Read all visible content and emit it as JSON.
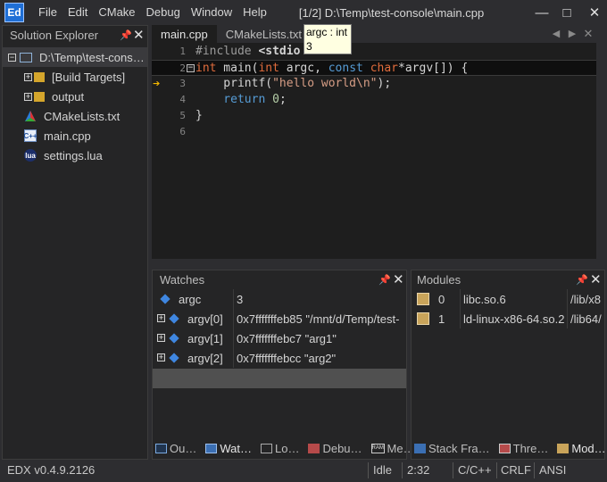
{
  "app": {
    "logo": "Ed",
    "window_title": "[1/2] D:\\Temp\\test-console\\main.cpp",
    "menu": [
      "File",
      "Edit",
      "CMake",
      "Debug",
      "Window",
      "Help"
    ],
    "window_buttons": {
      "minimize": "—",
      "maximize": "□",
      "close": "✕"
    }
  },
  "solution_explorer": {
    "title": "Solution Explorer",
    "items": [
      {
        "label": "D:\\Temp\\test-cons…",
        "icon": "solution-icon",
        "expander": "⊟"
      },
      {
        "label": "[Build Targets]",
        "icon": "build-targets-folder-icon",
        "expander": "+"
      },
      {
        "label": "output",
        "icon": "folder-icon",
        "expander": "+"
      },
      {
        "label": "CMakeLists.txt",
        "icon": "cmake-icon"
      },
      {
        "label": "main.cpp",
        "icon": "cpp-file-icon",
        "badge": "C++"
      },
      {
        "label": "settings.lua",
        "icon": "lua-file-icon",
        "badge": "lua"
      }
    ]
  },
  "editor": {
    "tabs": [
      "main.cpp",
      "CMakeLists.txt"
    ],
    "active_tab": 0,
    "line_numbers": [
      "1",
      "2",
      "3",
      "4",
      "5",
      "6"
    ],
    "code": {
      "l1_pp": "#include",
      "l1_rest": " <stdio",
      "l2_type1": "int",
      "l2_a": " main(",
      "l2_type2": "int",
      "l2_b": " argc, ",
      "l2_kw": "const",
      "l2_c": " ",
      "l2_type3": "char",
      "l2_d": "*argv[]) {",
      "l3_a": "    printf(",
      "l3_str": "\"hello world\\n\"",
      "l3_b": ");",
      "l4_kw": "    return",
      "l4_a": " ",
      "l4_num": "0",
      "l4_b": ";",
      "l5": "}"
    },
    "tooltip": {
      "line1": "argc : int",
      "line2": "3"
    },
    "current_line_marker": "➔"
  },
  "watches": {
    "title": "Watches",
    "rows": [
      {
        "name": "argc",
        "value": "3",
        "expandable": false
      },
      {
        "name": "argv[0]",
        "value": "0x7fffffffeb85 \"/mnt/d/Temp/test-",
        "expandable": true
      },
      {
        "name": "argv[1]",
        "value": "0x7fffffffebc7 \"arg1\"",
        "expandable": true
      },
      {
        "name": "argv[2]",
        "value": "0x7fffffffebcc \"arg2\"",
        "expandable": true
      }
    ],
    "tabs": [
      "Ou…",
      "Wat…",
      "Lo…",
      "Debu…",
      "Me…"
    ],
    "active_tab": 1
  },
  "modules": {
    "title": "Modules",
    "rows": [
      {
        "index": "0",
        "name": "libc.so.6",
        "path": "/lib/x8"
      },
      {
        "index": "1",
        "name": "ld-linux-x86-64.so.2",
        "path": "/lib64/"
      }
    ],
    "tabs": [
      "Stack Fra…",
      "Thre…",
      "Mod…"
    ],
    "active_tab": 2
  },
  "status": {
    "version": "EDX v0.4.9.2126",
    "state": "Idle",
    "position": "2:32",
    "language": "C/C++",
    "line_ending": "CRLF",
    "encoding": "ANSI"
  },
  "colors": {
    "background": "#2d2d30",
    "panel": "#252526",
    "editor": "#1e1e1e",
    "keyword": "#569cd6",
    "type": "#e06c3c",
    "string": "#d69d85",
    "number": "#b5cea8",
    "accent": "#1f6fd6"
  }
}
